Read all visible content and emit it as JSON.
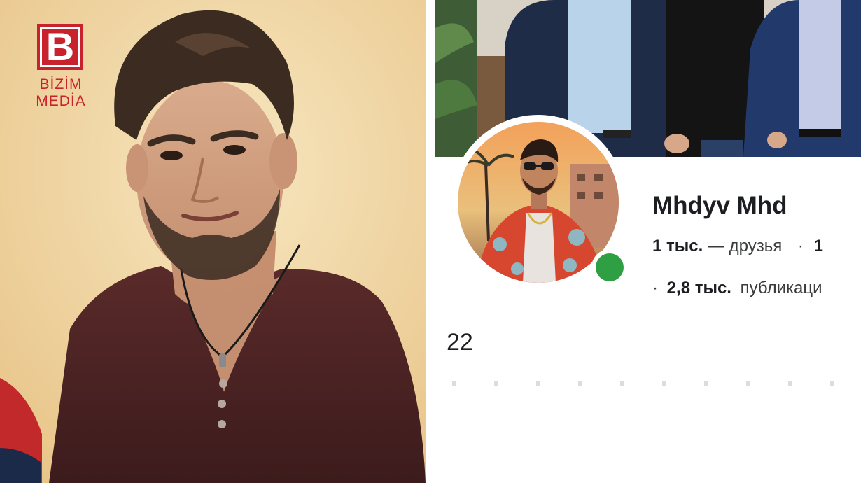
{
  "watermark": {
    "brand_line1": "BİZİM",
    "brand_line2": "MEDİA",
    "mark_letter": "B",
    "color": "#c8232c"
  },
  "left_photo": {
    "subject": "young-man-portrait"
  },
  "profile": {
    "name": "Mhdyv Mhd",
    "friends_count": "1 тыс.",
    "friends_label": "— друзья",
    "separator1": "·",
    "following_count_partial": "1",
    "separator2": "·",
    "posts_count": "2,8 тыс.",
    "posts_label": "публикаци",
    "bio_text": "22",
    "online_status_color": "#2ea043"
  }
}
